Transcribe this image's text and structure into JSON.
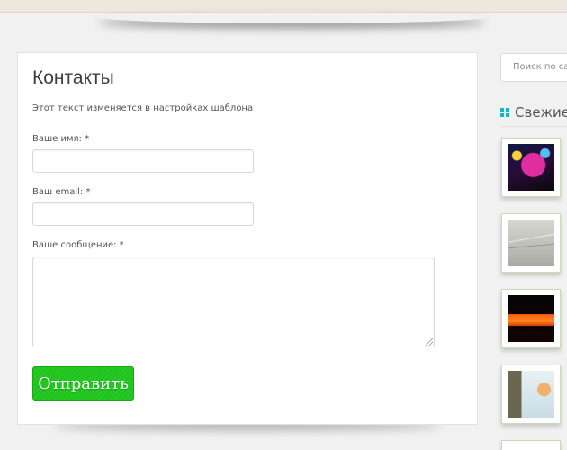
{
  "page": {
    "title": "Контакты",
    "intro_text": "Этот текст изменяется в настройках шаблона"
  },
  "form": {
    "name_label": "Ваше имя: *",
    "email_label": "Ваш email: *",
    "message_label": "Ваше сообщение: *",
    "name_value": "",
    "email_value": "",
    "message_value": "",
    "submit_label": "Отправить"
  },
  "sidebar": {
    "search_placeholder": "Поиск по са",
    "widget_title": "Свежие",
    "thumbnails": [
      {
        "icon": "fireworks-photo"
      },
      {
        "icon": "document-photo"
      },
      {
        "icon": "night-lights-photo"
      },
      {
        "icon": "coffee-photo"
      },
      {
        "icon": "photo"
      }
    ]
  },
  "colors": {
    "submit_button": "#1dc41b",
    "accent_icon": "#12b5c4",
    "background": "#f1f1f1"
  }
}
